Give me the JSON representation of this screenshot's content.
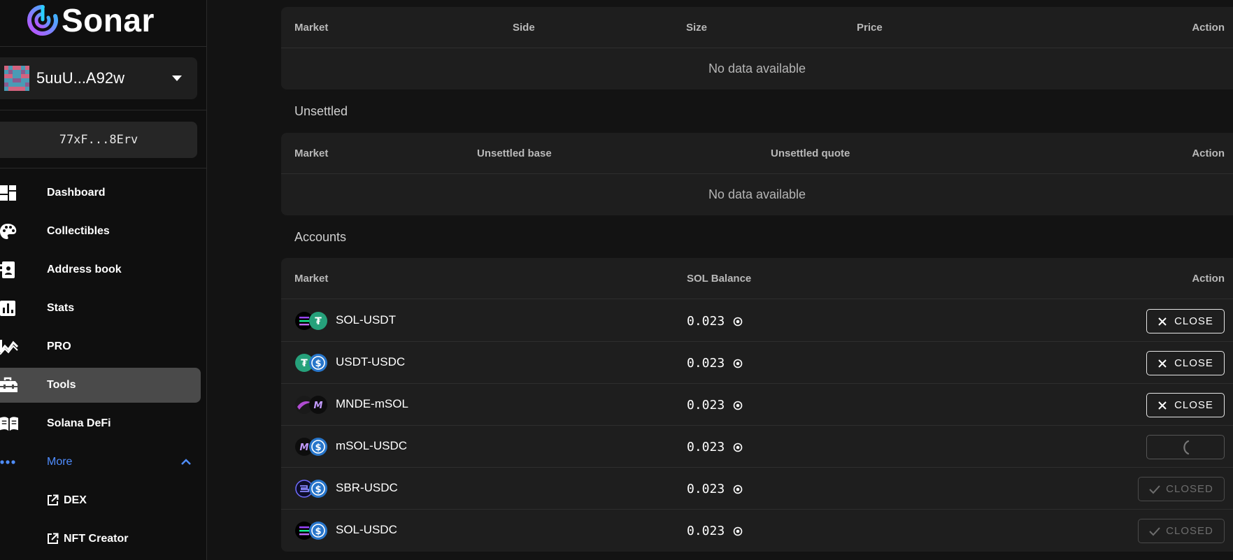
{
  "app": {
    "name": "Sonar"
  },
  "sidebar": {
    "wallet": {
      "label": "5uuU...A92w"
    },
    "account": {
      "label": "77xF...8Erv"
    },
    "items": [
      {
        "label": "Dashboard",
        "icon": "dashboard-icon"
      },
      {
        "label": "Collectibles",
        "icon": "palette-icon"
      },
      {
        "label": "Address book",
        "icon": "address-book-icon"
      },
      {
        "label": "Stats",
        "icon": "bar-chart-icon"
      },
      {
        "label": "PRO",
        "icon": "trend-chart-icon"
      },
      {
        "label": "Tools",
        "icon": "toolbox-icon",
        "active": true
      },
      {
        "label": "Solana DeFi",
        "icon": "book-open-icon"
      },
      {
        "label": "More",
        "icon": "more-dots-icon",
        "expanded": true
      }
    ],
    "sub_items": [
      {
        "label": "DEX",
        "icon": "external-link-icon"
      },
      {
        "label": "NFT Creator",
        "icon": "external-link-icon"
      }
    ]
  },
  "orders": {
    "columns": [
      "Market",
      "Side",
      "Size",
      "Price",
      "Action"
    ],
    "empty_text": "No data available"
  },
  "unsettled": {
    "title": "Unsettled",
    "columns": [
      "Market",
      "Unsettled base",
      "Unsettled quote",
      "Action"
    ],
    "empty_text": "No data available"
  },
  "accounts": {
    "title": "Accounts",
    "columns": [
      "Market",
      "SOL Balance",
      "Action"
    ],
    "rows": [
      {
        "market": "SOL-USDT",
        "balance": "0.023",
        "action": "CLOSE",
        "state": "close"
      },
      {
        "market": "USDT-USDC",
        "balance": "0.023",
        "action": "CLOSE",
        "state": "close"
      },
      {
        "market": "MNDE-mSOL",
        "balance": "0.023",
        "action": "CLOSE",
        "state": "close"
      },
      {
        "market": "mSOL-USDC",
        "balance": "0.023",
        "action": "",
        "state": "loading"
      },
      {
        "market": "SBR-USDC",
        "balance": "0.023",
        "action": "CLOSED",
        "state": "closed"
      },
      {
        "market": "SOL-USDC",
        "balance": "0.023",
        "action": "CLOSED",
        "state": "closed"
      }
    ]
  },
  "colors": {
    "accent": "#4f8dff",
    "active_nav": "#4a4a4a",
    "panel": "#1e1e1e"
  }
}
